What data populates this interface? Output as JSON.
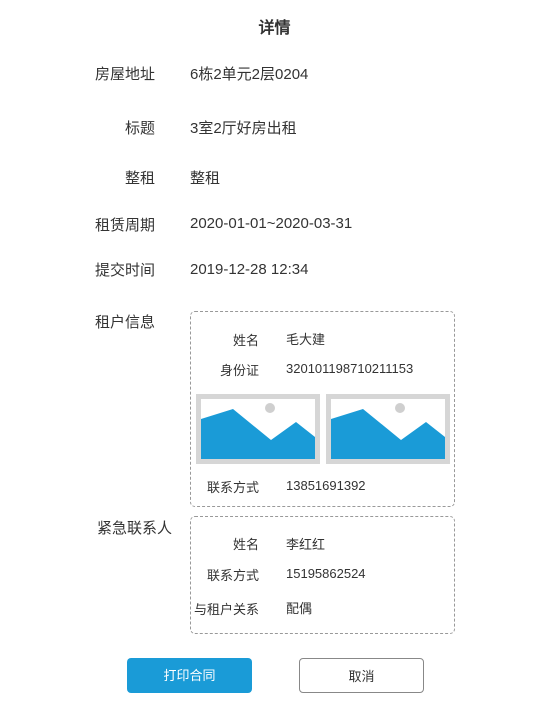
{
  "page": {
    "title": "详情"
  },
  "fields": {
    "address": {
      "label": "房屋地址",
      "value": "6栋2单元2层0204"
    },
    "subject": {
      "label": "标题",
      "value": "3室2厅好房出租"
    },
    "rent_type": {
      "label": "整租",
      "value": "整租"
    },
    "lease_period": {
      "label": "租赁周期",
      "value": "2020-01-01~2020-03-31"
    },
    "submit_time": {
      "label": "提交时间",
      "value": "2019-12-28 12:34"
    }
  },
  "tenant": {
    "section_label": "租户信息",
    "name_label": "姓名",
    "name": "毛大建",
    "id_label": "身份证",
    "id_number": "320101198710211153",
    "images": [
      "id-photo-front-icon",
      "id-photo-back-icon"
    ],
    "contact_label": "联系方式",
    "contact": "13851691392"
  },
  "emergency": {
    "section_label": "紧急联系人",
    "name_label": "姓名",
    "name": "李红红",
    "contact_label": "联系方式",
    "contact": "15195862524",
    "relation_label": "与租户关系",
    "relation": "配偶"
  },
  "actions": {
    "print_label": "打印合同",
    "cancel_label": "取消"
  },
  "colors": {
    "primary": "#1a9bd7",
    "image_placeholder": "#1a9bd7",
    "border": "#999999"
  }
}
